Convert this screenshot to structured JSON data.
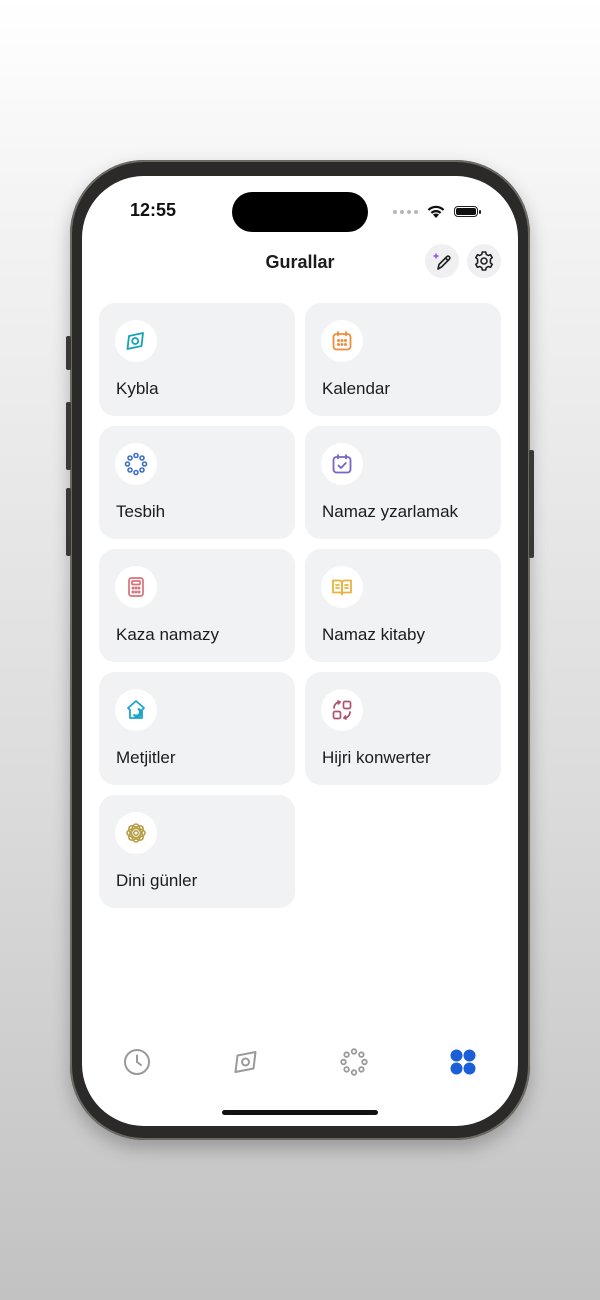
{
  "status_bar": {
    "time": "12:55"
  },
  "header": {
    "title": "Gurallar",
    "edit_icon": "sparkle-pencil-icon",
    "settings_icon": "gear-icon"
  },
  "tools": [
    {
      "label": "Kybla",
      "icon": "compass-icon",
      "color": "#17a2b8"
    },
    {
      "label": "Kalendar",
      "icon": "calendar-icon",
      "color": "#f08c3a"
    },
    {
      "label": "Tesbih",
      "icon": "tasbih-beads-icon",
      "color": "#3f6fc9"
    },
    {
      "label": "Namaz yzarlamak",
      "icon": "calendar-check-icon",
      "color": "#7a62c9"
    },
    {
      "label": "Kaza namazy",
      "icon": "calculator-icon",
      "color": "#d9707a"
    },
    {
      "label": "Namaz kitaby",
      "icon": "open-book-icon",
      "color": "#e8b33a"
    },
    {
      "label": "Metjitler",
      "icon": "mosque-icon",
      "color": "#1aa6c8"
    },
    {
      "label": "Hijri konwerter",
      "icon": "convert-arrows-icon",
      "color": "#b0526b"
    },
    {
      "label": "Dini günler",
      "icon": "ornament-icon",
      "color": "#b6a048"
    }
  ],
  "tabbar": {
    "items": [
      {
        "icon": "clock-icon",
        "active": false
      },
      {
        "icon": "compass-icon",
        "active": false
      },
      {
        "icon": "tasbih-beads-icon",
        "active": false
      },
      {
        "icon": "grid-dots-icon",
        "active": true
      }
    ],
    "active_color": "#1a5fd8",
    "inactive_color": "#9a9a9a"
  }
}
